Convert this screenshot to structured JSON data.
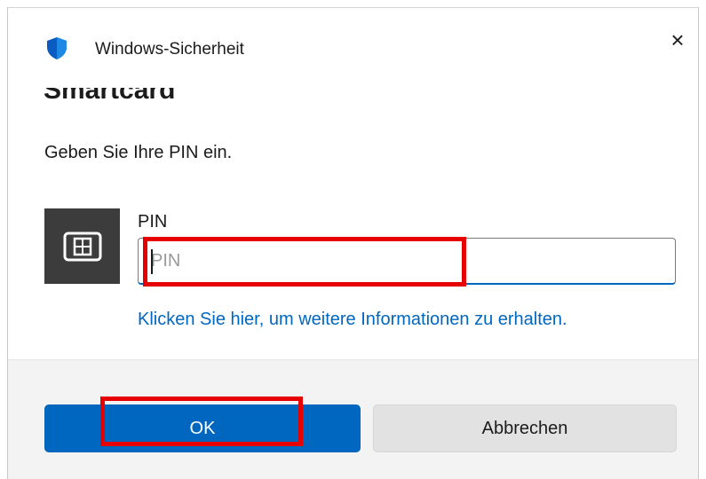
{
  "window": {
    "title": "Windows-Sicherheit",
    "close_label": "×"
  },
  "content": {
    "heading": "Smartcard",
    "prompt": "Geben Sie Ihre PIN ein.",
    "pin_label": "PIN",
    "pin_placeholder": "PIN",
    "pin_value": "",
    "info_link": "Klicken Sie hier, um weitere Informationen zu erhalten."
  },
  "buttons": {
    "ok": "OK",
    "cancel": "Abbrechen"
  },
  "icons": {
    "app": "shield-icon",
    "close": "close-icon",
    "card": "smartcard-icon"
  },
  "colors": {
    "accent": "#0067c0",
    "highlight": "#e60000",
    "card_tile": "#3c3c3c",
    "footer": "#f3f3f3"
  }
}
